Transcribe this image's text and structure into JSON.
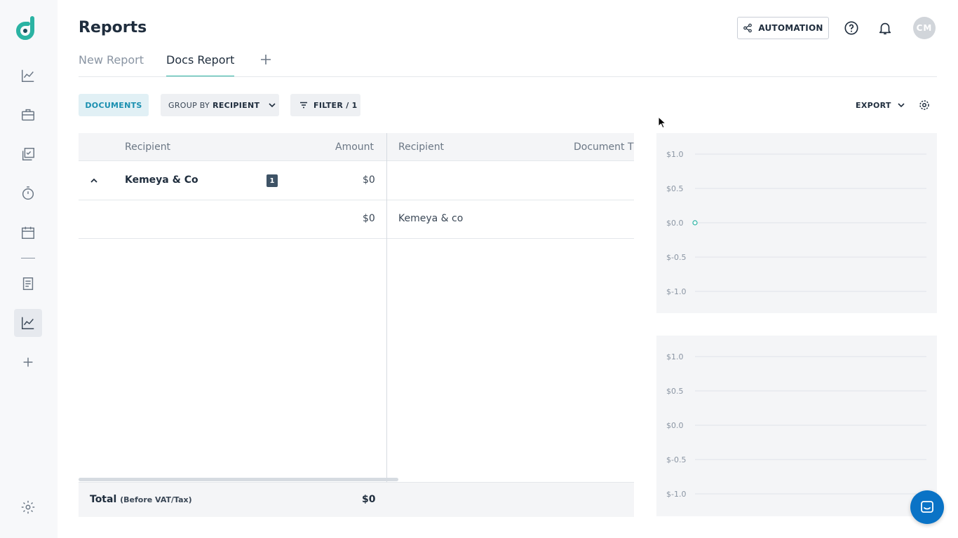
{
  "app": {
    "logo_letter": "d",
    "brand_color": "#2bb3a3"
  },
  "header": {
    "title": "Reports",
    "automation_label": "AUTOMATION",
    "avatar_initials": "CM"
  },
  "tabs": [
    {
      "label": "New Report",
      "active": false
    },
    {
      "label": "Docs Report",
      "active": true
    }
  ],
  "toolbar": {
    "documents_label": "DOCUMENTS",
    "group_by_prefix": "GROUP BY",
    "group_by_value": "RECIPIENT",
    "filter_label": "FILTER / 1",
    "export_label": "EXPORT"
  },
  "table": {
    "left_headers": {
      "recipient": "Recipient",
      "amount": "Amount"
    },
    "right_headers": {
      "recipient": "Recipient",
      "document_type": "Document T"
    },
    "group_row": {
      "name": "Kemeya & Co",
      "count": "1",
      "amount": "$0"
    },
    "detail_row": {
      "amount": "$0",
      "recipient": "Kemeya & co"
    },
    "footer": {
      "label": "Total",
      "sublabel": "(Before VAT/Tax)",
      "value": "$0"
    }
  },
  "chart_data": [
    {
      "type": "line",
      "ylim": [
        -1.0,
        1.0
      ],
      "y_ticks": [
        "$1.0",
        "$0.5",
        "$0.0",
        "$-0.5",
        "$-1.0"
      ],
      "series": [
        {
          "values": [
            0.0
          ]
        }
      ],
      "grid": true,
      "point_color": "#2bb3a3"
    },
    {
      "type": "line",
      "ylim": [
        -1.0,
        1.0
      ],
      "y_ticks": [
        "$1.0",
        "$0.5",
        "$0.0",
        "$-0.5",
        "$-1.0"
      ],
      "series": [],
      "grid": true
    }
  ]
}
